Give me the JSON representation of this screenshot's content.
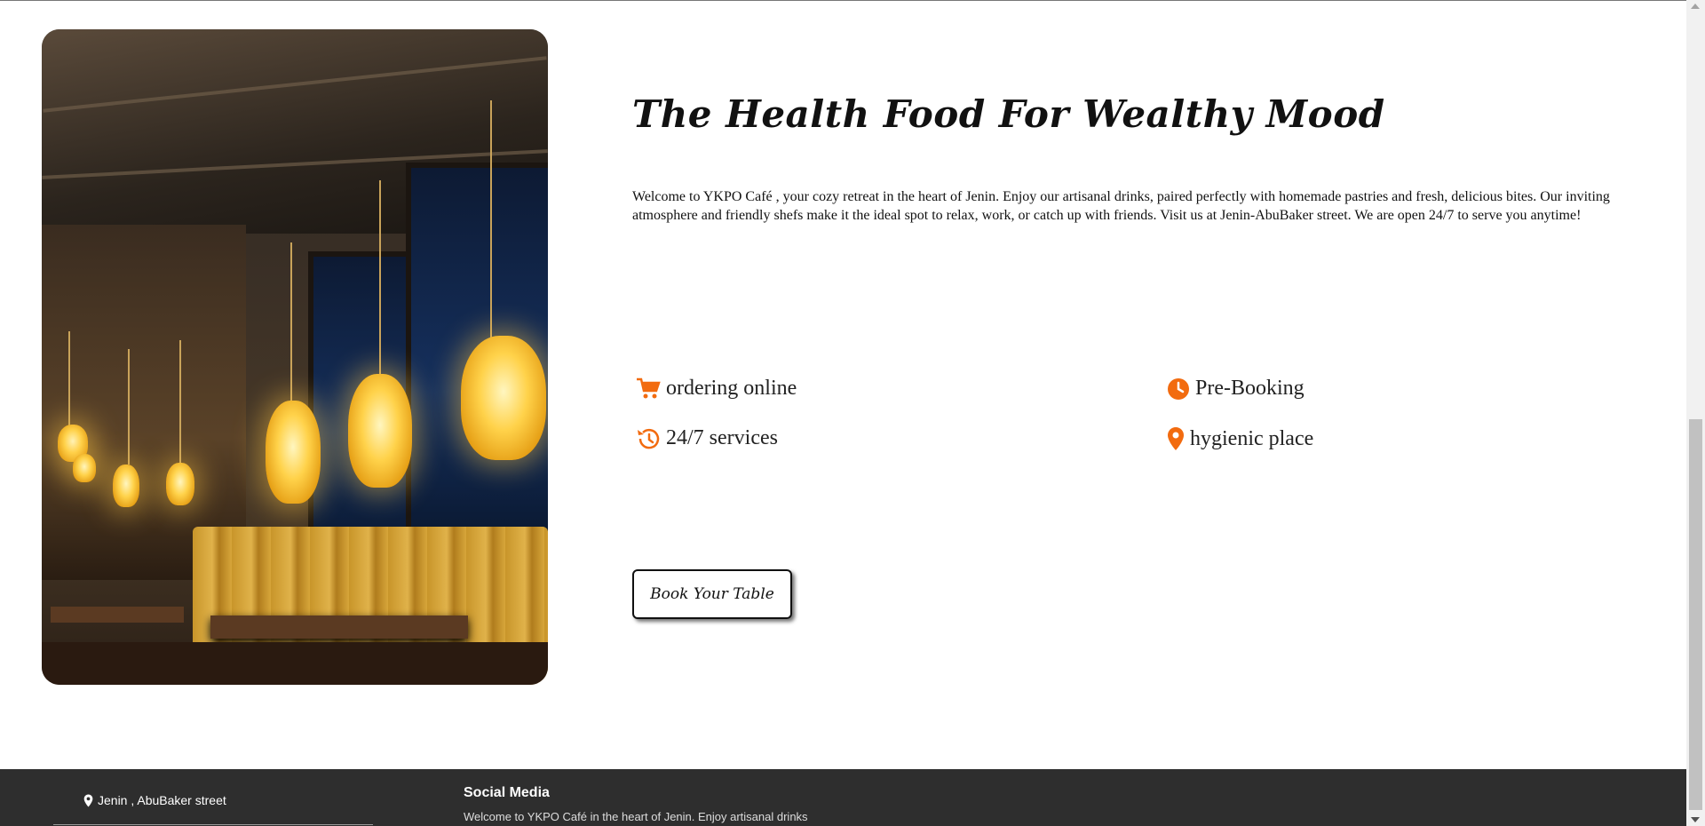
{
  "about": {
    "title": "The Health Food For Wealthy Mood",
    "description": "Welcome to YKPO Café , your cozy retreat in the heart of Jenin. Enjoy our artisanal drinks, paired perfectly with homemade pastries and fresh, delicious bites. Our inviting atmosphere and friendly shefs make it the ideal spot to relax, work, or catch up with friends. Visit us at Jenin-AbuBaker street. We are open 24/7 to serve you anytime!",
    "features": [
      {
        "label": "ordering online",
        "icon": "cart-icon"
      },
      {
        "label": "Pre-Booking",
        "icon": "clock-icon"
      },
      {
        "label": "24/7 services",
        "icon": "history-icon"
      },
      {
        "label": "hygienic place",
        "icon": "location-pin-icon"
      }
    ],
    "book_button": "Book Your Table",
    "accent_color": "#f26b0f"
  },
  "footer": {
    "address": "Jenin , AbuBaker street",
    "social_title": "Social Media",
    "social_text": "Welcome to YKPO Café in the heart of Jenin. Enjoy artisanal drinks"
  }
}
